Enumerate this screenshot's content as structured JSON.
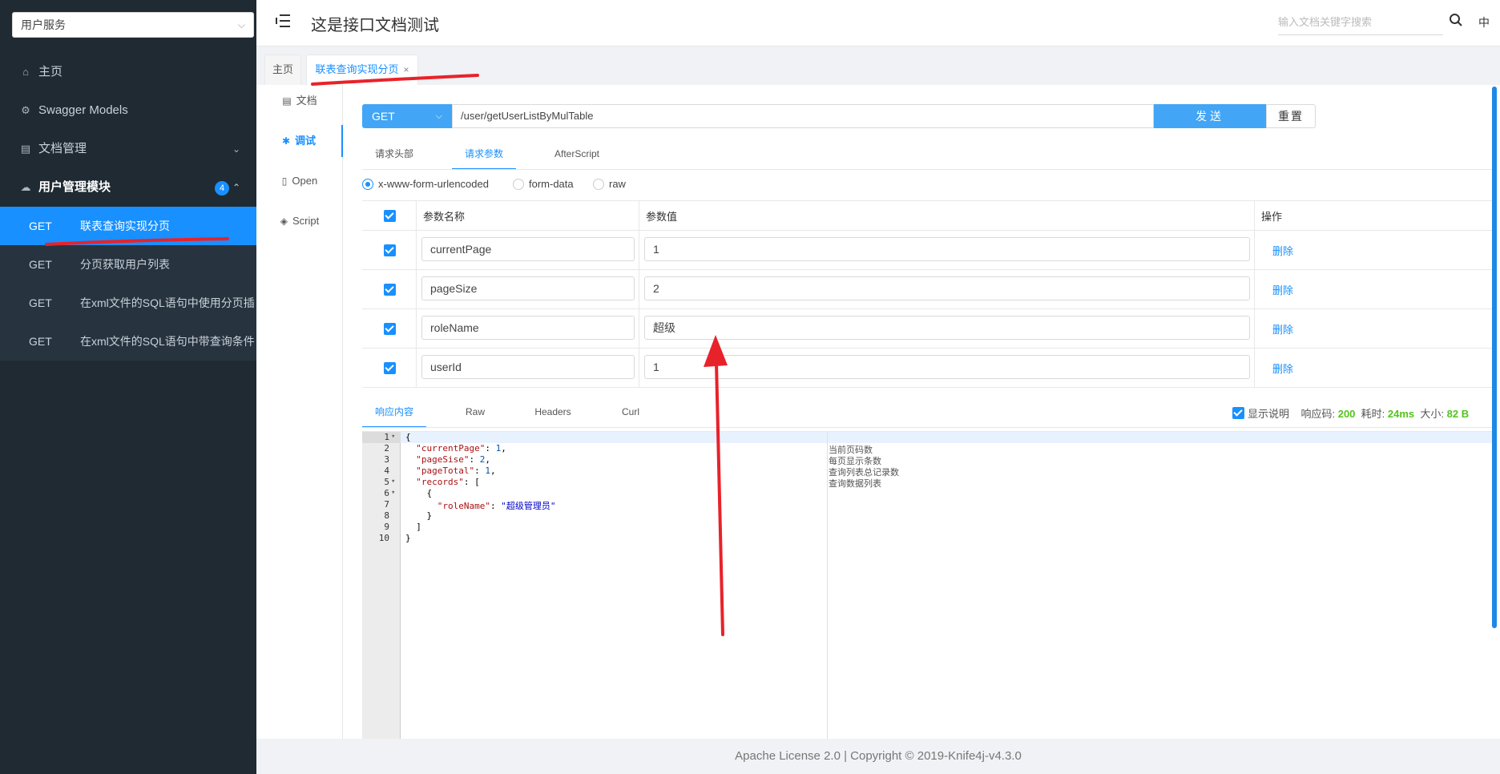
{
  "sidebar": {
    "service_select": "用户服务",
    "menu": [
      {
        "label": "主页",
        "icon": "home-icon"
      },
      {
        "label": "Swagger Models",
        "icon": "cube-icon"
      },
      {
        "label": "文档管理",
        "icon": "document-icon"
      },
      {
        "label": "用户管理模块",
        "icon": "cloud-icon",
        "badge": "4"
      }
    ],
    "sub_items": [
      {
        "method": "GET",
        "label": "联表查询实现分页",
        "active": true
      },
      {
        "method": "GET",
        "label": "分页获取用户列表"
      },
      {
        "method": "GET",
        "label": "在xml文件的SQL语句中使用分页插"
      },
      {
        "method": "GET",
        "label": "在xml文件的SQL语句中带查询条件"
      }
    ]
  },
  "header": {
    "title": "这是接口文档测试",
    "search_placeholder": "输入文档关键字搜索",
    "lang": "中"
  },
  "tabs": [
    {
      "label": "主页"
    },
    {
      "label": "联表查询实现分页",
      "active": true,
      "closable": "×"
    }
  ],
  "vnav": [
    {
      "label": "文档",
      "icon": "doc-icon"
    },
    {
      "label": "调试",
      "icon": "bug-icon",
      "active": true
    },
    {
      "label": "Open",
      "icon": "file-icon"
    },
    {
      "label": "Script",
      "icon": "script-icon"
    }
  ],
  "request": {
    "method": "GET",
    "url": "/user/getUserListByMulTable",
    "send_label": "发送",
    "reset_label": "重置",
    "tabs": [
      "请求头部",
      "请求参数",
      "AfterScript"
    ],
    "active_tab": "请求参数",
    "content_types": [
      "x-www-form-urlencoded",
      "form-data",
      "raw"
    ],
    "selected_content_type": "x-www-form-urlencoded"
  },
  "params_table": {
    "headers": {
      "name": "参数名称",
      "value": "参数值",
      "op": "操作"
    },
    "rows": [
      {
        "checked": true,
        "name": "currentPage",
        "value": "1",
        "op": "删除"
      },
      {
        "checked": true,
        "name": "pageSize",
        "value": "2",
        "op": "删除"
      },
      {
        "checked": true,
        "name": "roleName",
        "value": "超级",
        "op": "删除"
      },
      {
        "checked": true,
        "name": "userId",
        "value": "1",
        "op": "删除"
      }
    ]
  },
  "response": {
    "tabs": [
      "响应内容",
      "Raw",
      "Headers",
      "Curl"
    ],
    "active_tab": "响应内容",
    "show_desc_label": "显示说明",
    "status_label": "响应码:",
    "status": "200",
    "time_label": "耗时:",
    "time": "24ms",
    "size_label": "大小:",
    "size": "82 B",
    "line_numbers": [
      "1",
      "2",
      "3",
      "4",
      "5",
      "6",
      "7",
      "8",
      "9",
      "10"
    ],
    "folds": [
      "▾",
      "",
      "",
      "",
      "▾",
      "▾",
      "",
      "",
      "",
      ""
    ],
    "code_lines": [
      [
        {
          "t": "{",
          "c": ""
        }
      ],
      [
        {
          "t": "  ",
          "c": ""
        },
        {
          "t": "\"currentPage\"",
          "c": "k"
        },
        {
          "t": ": ",
          "c": ""
        },
        {
          "t": "1",
          "c": "n"
        },
        {
          "t": ",",
          "c": ""
        }
      ],
      [
        {
          "t": "  ",
          "c": ""
        },
        {
          "t": "\"pageSise\"",
          "c": "k"
        },
        {
          "t": ": ",
          "c": ""
        },
        {
          "t": "2",
          "c": "n"
        },
        {
          "t": ",",
          "c": ""
        }
      ],
      [
        {
          "t": "  ",
          "c": ""
        },
        {
          "t": "\"pageTotal\"",
          "c": "k"
        },
        {
          "t": ": ",
          "c": ""
        },
        {
          "t": "1",
          "c": "n"
        },
        {
          "t": ",",
          "c": ""
        }
      ],
      [
        {
          "t": "  ",
          "c": ""
        },
        {
          "t": "\"records\"",
          "c": "k"
        },
        {
          "t": ": [",
          "c": ""
        }
      ],
      [
        {
          "t": "    {",
          "c": ""
        }
      ],
      [
        {
          "t": "      ",
          "c": ""
        },
        {
          "t": "\"roleName\"",
          "c": "k"
        },
        {
          "t": ": ",
          "c": ""
        },
        {
          "t": "\"超级管理员\"",
          "c": "s"
        }
      ],
      [
        {
          "t": "    }",
          "c": ""
        }
      ],
      [
        {
          "t": "  ]",
          "c": ""
        }
      ],
      [
        {
          "t": "}",
          "c": ""
        }
      ]
    ],
    "descriptions": [
      "当前页码数",
      "每页显示条数",
      "查询列表总记录数",
      "查询数据列表"
    ]
  },
  "footer": "Apache License 2.0 | Copyright © 2019-Knife4j-v4.3.0",
  "colors": {
    "accent": "#1890ff",
    "sidebar_bg": "#1f2a33",
    "annotation": "#e8222a"
  }
}
